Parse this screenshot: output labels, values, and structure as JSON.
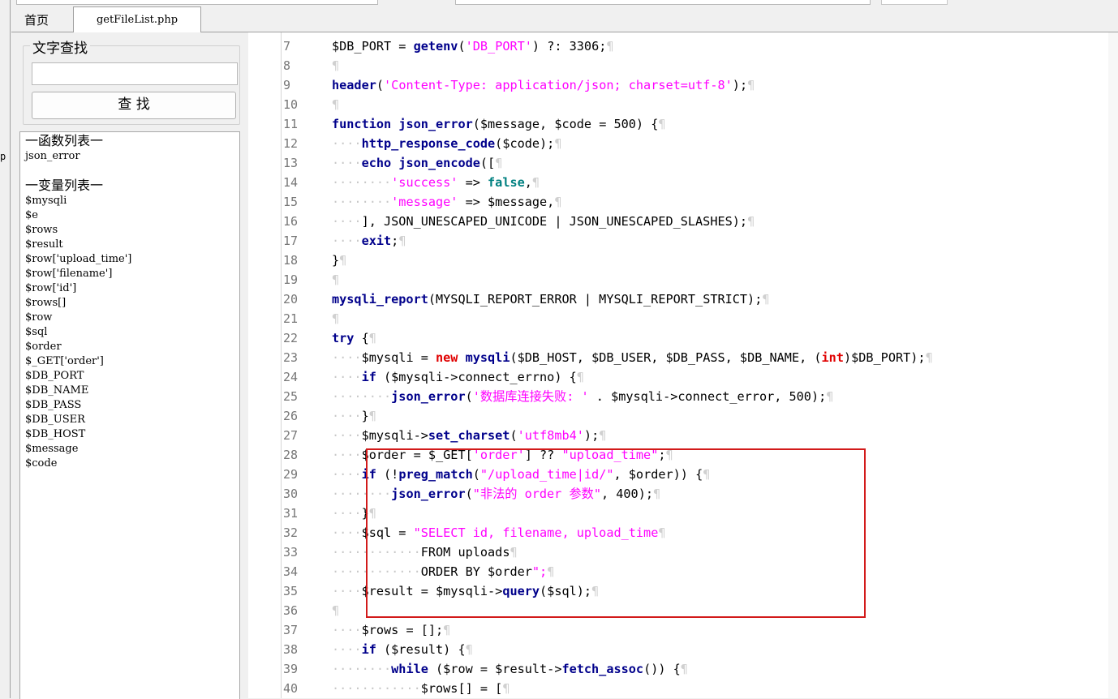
{
  "tabs": {
    "home": "首页",
    "file": "getFileList.php"
  },
  "left_track": {
    "glyph": "p"
  },
  "search": {
    "legend": "文字查找",
    "value": "",
    "button": "查 找"
  },
  "outline": {
    "functions_header": "一函数列表一",
    "functions": [
      "json_error"
    ],
    "variables_header": "一变量列表一",
    "variables": [
      "$mysqli",
      "$e",
      "$rows",
      "$result",
      "$row['upload_time']",
      "$row['filename']",
      "$row['id']",
      "$rows[]",
      "$row",
      "$sql",
      "$order",
      "$_GET['order']",
      "$DB_PORT",
      "$DB_NAME",
      "$DB_PASS",
      "$DB_USER",
      "$DB_HOST",
      "$message",
      "$code"
    ]
  },
  "code": {
    "line_numbers": [
      "7",
      "8",
      "9",
      "10",
      "11",
      "12",
      "13",
      "14",
      "15",
      "16",
      "17",
      "18",
      "19",
      "20",
      "21",
      "22",
      "23",
      "24",
      "25",
      "26",
      "27",
      "28",
      "29",
      "30",
      "31",
      "32",
      "33",
      "34",
      "35",
      "36",
      "37",
      "38",
      "39",
      "40"
    ],
    "lines": [
      "$DB_PORT = getenv('DB_PORT') ?: 3306;",
      "",
      "header('Content-Type: application/json; charset=utf-8');",
      "",
      "function json_error($message, $code = 500) {",
      "    http_response_code($code);",
      "    echo json_encode([",
      "        'success' => false,",
      "        'message' => $message,",
      "    ], JSON_UNESCAPED_UNICODE | JSON_UNESCAPED_SLASHES);",
      "    exit;",
      "}",
      "",
      "mysqli_report(MYSQLI_REPORT_ERROR | MYSQLI_REPORT_STRICT);",
      "",
      "try {",
      "    $mysqli = new mysqli($DB_HOST, $DB_USER, $DB_PASS, $DB_NAME, (int)$DB_PORT);",
      "    if ($mysqli->connect_errno) {",
      "        json_error('数据库连接失败: ' . $mysqli->connect_error, 500);",
      "    }",
      "    $mysqli->set_charset('utf8mb4');",
      "    $order = $_GET['order'] ?? \"upload_time\";",
      "    if (!preg_match(\"/upload_time|id/\", $order)) {",
      "        json_error(\"非法的 order 参数\", 400);",
      "    }",
      "    $sql = \"SELECT id, filename, upload_time",
      "            FROM uploads",
      "            ORDER BY $order\";",
      "    $result = $mysqli->query($sql);",
      "",
      "    $rows = [];",
      "    if ($result) {",
      "        while ($row = $result->fetch_assoc()) {",
      "            $rows[] = ["
    ]
  },
  "colors": {
    "keyword": "#00008b",
    "string": "#ff00ff",
    "constant": "#008080",
    "new_keyword": "#e00000",
    "highlight_border": "#d21a1a"
  }
}
